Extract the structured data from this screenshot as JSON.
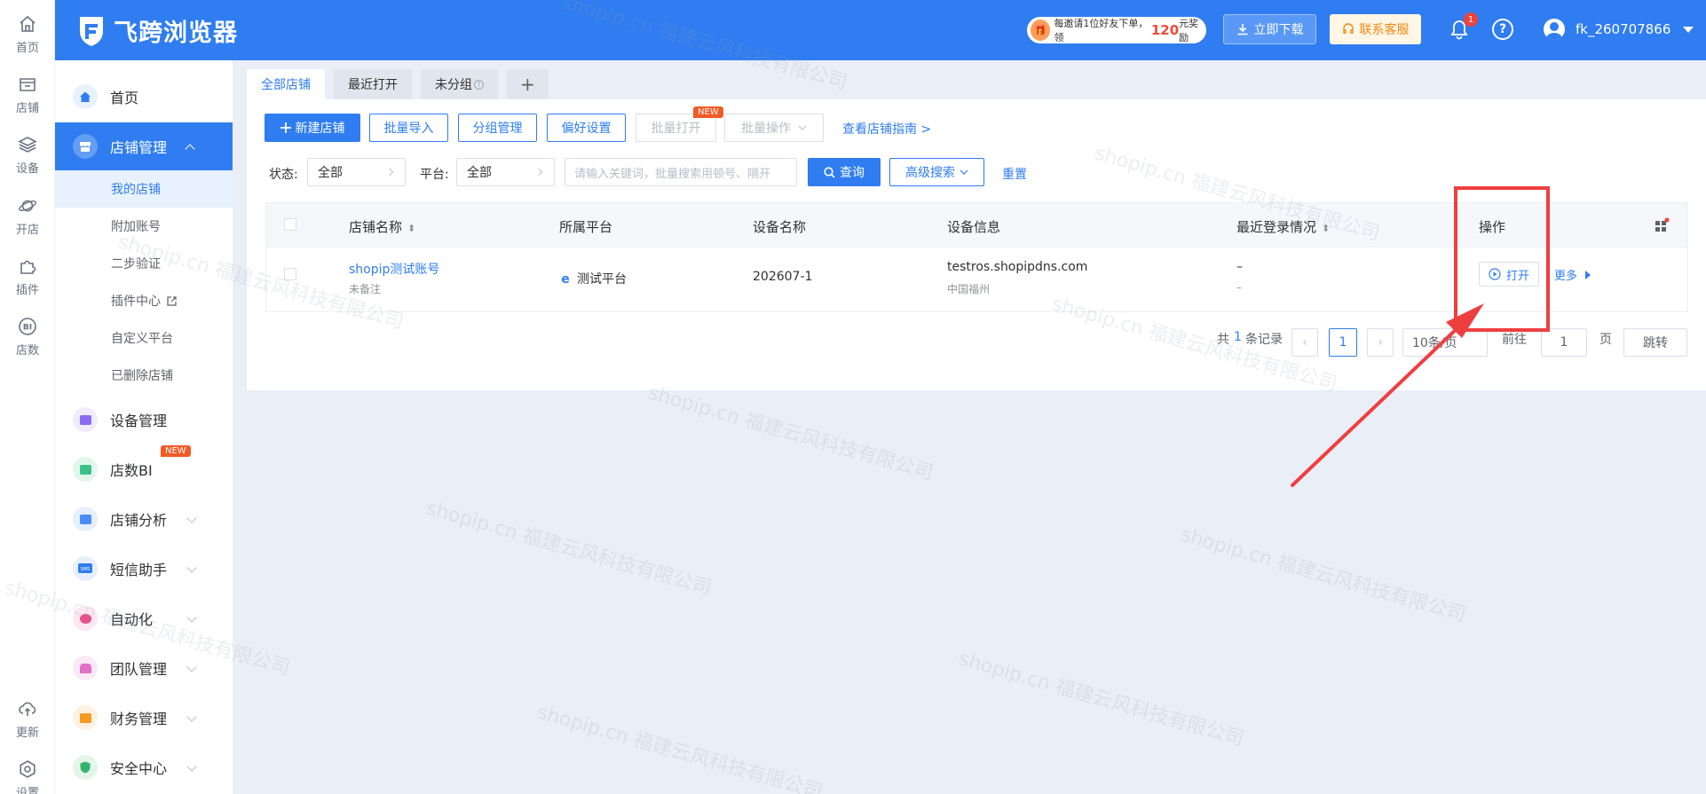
{
  "app": {
    "title": "飞跨浏览器",
    "invite_prefix": "每邀请1位好友下单，领",
    "invite_amount": "120",
    "invite_suffix": "元奖励",
    "download_label": "立即下载",
    "service_label": "联系客服",
    "notification_count": "1",
    "help_label": "?",
    "username": "fk_260707866"
  },
  "rail": {
    "items": [
      {
        "label": "首页"
      },
      {
        "label": "店铺"
      },
      {
        "label": "设备"
      },
      {
        "label": "开店"
      },
      {
        "label": "插件"
      },
      {
        "label": "店数"
      },
      {
        "label": "更新"
      },
      {
        "label": "设置"
      }
    ],
    "bi_icon_text": "BI"
  },
  "sidebar": {
    "home": "首页",
    "store_management": "店铺管理",
    "sub_items": [
      {
        "label": "我的店铺"
      },
      {
        "label": "附加账号"
      },
      {
        "label": "二步验证"
      },
      {
        "label": "插件中心"
      },
      {
        "label": "自定义平台"
      },
      {
        "label": "已删除店铺"
      }
    ],
    "items": [
      {
        "label": "设备管理"
      },
      {
        "label": "店数BI"
      },
      {
        "label": "店铺分析"
      },
      {
        "label": "短信助手"
      },
      {
        "label": "自动化"
      },
      {
        "label": "团队管理"
      },
      {
        "label": "财务管理"
      },
      {
        "label": "安全中心"
      }
    ],
    "new_tag": "NEW",
    "sms_icon_text": "SMS",
    "colors": {
      "active": "#2f7df0",
      "device": "#8b6cf0",
      "bi": "#3cc08a",
      "analysis": "#4b8df5",
      "sms": "#2f7df0",
      "auto": "#e8508a",
      "team": "#e070c8",
      "finance": "#f59a23",
      "security": "#34b46a"
    }
  },
  "tabs": [
    {
      "label": "全部店铺"
    },
    {
      "label": "最近打开"
    },
    {
      "label": "未分组"
    },
    {
      "label": "+"
    }
  ],
  "toolbar": {
    "new_store": "新建店铺",
    "batch_import": "批量导入",
    "group_manage": "分组管理",
    "preferences": "偏好设置",
    "batch_open": "批量打开",
    "batch_ops": "批量操作",
    "guide_link": "查看店铺指南 >",
    "new_tag": "NEW"
  },
  "filters": {
    "status_label": "状态:",
    "status_value": "全部",
    "platform_label": "平台:",
    "platform_value": "全部",
    "search_placeholder": "请输入关键词，批量搜索用顿号、隔开",
    "query_btn": "查询",
    "advanced_btn": "高级搜索",
    "reset_btn": "重置"
  },
  "table": {
    "columns": [
      "店铺名称",
      "所属平台",
      "设备名称",
      "设备信息",
      "最近登录情况",
      "操作"
    ],
    "rows": [
      {
        "name": "shopip测试账号",
        "note": "未备注",
        "platform": "测试平台",
        "device_name": "202607-1",
        "device_host": "testros.shopipdns.com",
        "device_location": "中国福州",
        "login_main": "–",
        "login_sub": "–",
        "open_label": "打开",
        "more_label": "更多"
      }
    ]
  },
  "pagination": {
    "total_prefix": "共",
    "total": "1",
    "total_suffix": "条记录",
    "current_page": "1",
    "page_size": "10条/页",
    "goto_label": "前往",
    "goto_value": "1",
    "page_unit": "页",
    "jump_label": "跳转"
  },
  "watermark": "shopip.cn 福建云风科技有限公司",
  "annotation": {
    "color": "#ee3f3f"
  }
}
